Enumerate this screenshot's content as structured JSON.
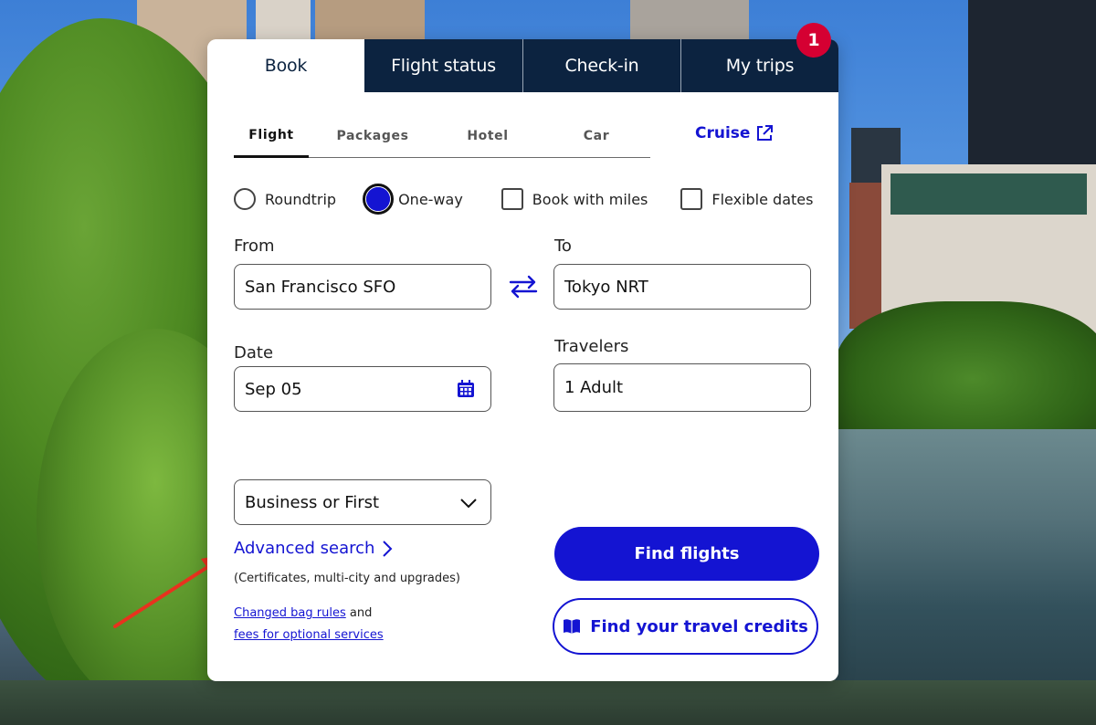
{
  "top_tabs": [
    {
      "label": "Book",
      "active": true
    },
    {
      "label": "Flight status",
      "active": false
    },
    {
      "label": "Check-in",
      "active": false
    },
    {
      "label": "My trips",
      "active": false
    }
  ],
  "trips_badge": "1",
  "sub_tabs": [
    {
      "label": "Flight",
      "active": true
    },
    {
      "label": "Packages",
      "active": false
    },
    {
      "label": "Hotel",
      "active": false
    },
    {
      "label": "Car",
      "active": false
    }
  ],
  "cruise_label": "Cruise",
  "trip_options": {
    "roundtrip": "Roundtrip",
    "oneway": "One-way",
    "miles": "Book with miles",
    "flexible": "Flexible dates",
    "selected": "One-way"
  },
  "from": {
    "label": "From",
    "value": "San Francisco SFO"
  },
  "to": {
    "label": "To",
    "value": "Tokyo NRT"
  },
  "date": {
    "label": "Date",
    "value": "Sep 05"
  },
  "travelers": {
    "label": "Travelers",
    "value": "1 Adult"
  },
  "cabin": {
    "value": "Business or First"
  },
  "advanced": {
    "label": "Advanced search",
    "sub": "(Certificates, multi-city and upgrades)"
  },
  "bag": {
    "link1": "Changed bag rules",
    "and": " and",
    "link2": "fees for optional services"
  },
  "buttons": {
    "find_flights": "Find flights",
    "travel_credits": "Find your travel credits"
  },
  "colors": {
    "navy": "#0c2340",
    "accent_blue": "#1414d2",
    "badge_red": "#d50032",
    "annotation_arrow": "#e8321e"
  }
}
